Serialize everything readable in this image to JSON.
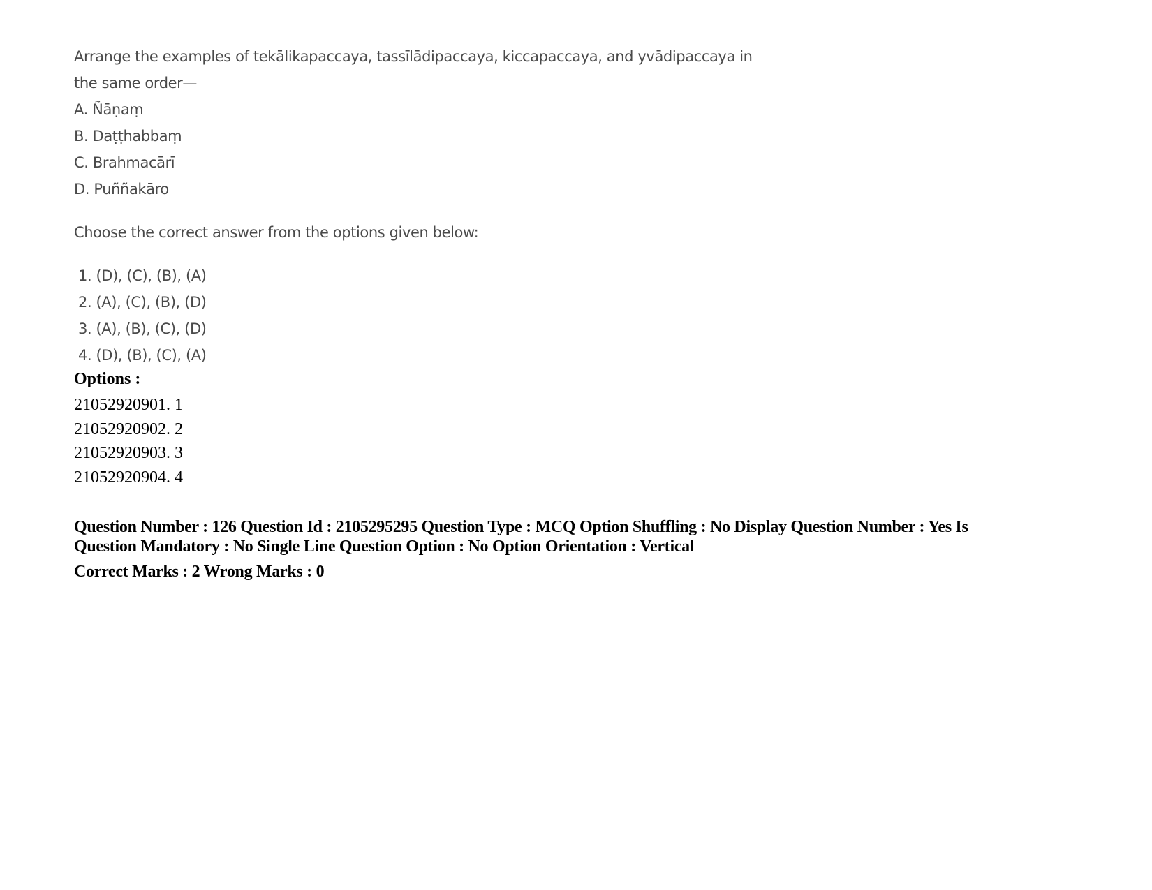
{
  "question": {
    "stem_line1": "Arrange the examples of tekālikapaccaya, tassīlādipaccaya, kiccapaccaya, and yvādipaccaya in",
    "stem_line2": "the same order—",
    "items": [
      "A. Ñāṇaṃ",
      "B. Daṭṭhabbaṃ",
      "C. Brahmacārī",
      "D. Puññakāro"
    ],
    "instruction": "Choose the correct answer from the options given below:",
    "choices": [
      "1. (D), (C), (B), (A)",
      "2. (A), (C), (B), (D)",
      "3. (A), (B), (C), (D)",
      "4. (D), (B), (C), (A)"
    ]
  },
  "options": {
    "heading": "Options :",
    "list": [
      "21052920901. 1",
      "21052920902. 2",
      "21052920903. 3",
      "21052920904. 4"
    ]
  },
  "next_question_meta": {
    "line1": "Question Number : 126 Question Id : 2105295295 Question Type : MCQ Option Shuffling : No Display Question Number : Yes Is",
    "line2": "Question Mandatory : No Single Line Question Option : No Option Orientation : Vertical",
    "marks": "Correct Marks : 2 Wrong Marks : 0"
  }
}
